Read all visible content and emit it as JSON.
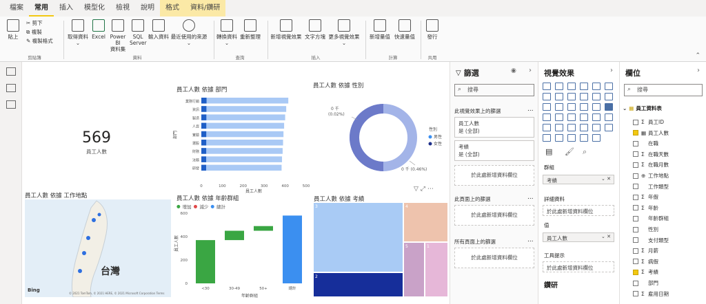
{
  "tabs": [
    "檔案",
    "常用",
    "插入",
    "模型化",
    "檢視",
    "說明",
    "格式",
    "資料/鑽研"
  ],
  "ribbon": {
    "clipboard": {
      "paste": "貼上",
      "cut": "剪下",
      "copy": "複製",
      "format_painter": "複製格式",
      "group": "剪貼簿"
    },
    "data": {
      "get_data": "取得資料",
      "excel": "Excel",
      "pbi_1": "Power BI",
      "pbi_2": "資料集",
      "sql_1": "SQL",
      "sql_2": "Server",
      "enter": "輸入資料",
      "recent": "最近使用的來源",
      "group": "資料"
    },
    "queries": {
      "transform": "轉換資料",
      "refresh": "重新整理",
      "group": "查詢"
    },
    "insert": {
      "new_visual": "新增視覺效果",
      "textbox": "文字方塊",
      "more_visuals": "更多視覺效果",
      "group": "插入"
    },
    "calc": {
      "new_measure": "新增量值",
      "quick_measure": "快速量值",
      "group": "計算"
    },
    "share": {
      "publish": "發行",
      "group": "共用"
    }
  },
  "card": {
    "value": "569",
    "label": "員工人數"
  },
  "bar_chart_title": "員工人數 依據 部門",
  "donut_title": "員工人數 依據 性別",
  "waterfall_title": "員工人數 依據 年齡群組",
  "treemap_title": "員工人數 依據 考績",
  "map_title": "員工人數 依據 工作地點",
  "map": {
    "region_label": "台灣",
    "bing": "Bing",
    "copyright": "© 2021 TomTom, © 2021 HERE, © 2021 Microsoft Corporation  Terms"
  },
  "chart_data": [
    {
      "type": "bar",
      "title": "員工人數 依據 部門",
      "categories": [
        "業務行銷",
        "資訊",
        "製造",
        "人資",
        "實驗",
        "選股",
        "財務",
        "法務",
        "研發"
      ],
      "series": [
        {
          "values": [
            415,
            405,
            400,
            395,
            392,
            390,
            388,
            385,
            383
          ]
        }
      ],
      "xlabel": "員工人數",
      "ylabel": "部門",
      "x_ticks": [
        "0",
        "100",
        "200",
        "300",
        "400",
        "500"
      ],
      "xlim": [
        0,
        500
      ]
    },
    {
      "type": "pie",
      "title": "員工人數 依據 性別",
      "legend_title": "性別",
      "legend": [
        "男性",
        "女性"
      ],
      "labels": [
        {
          "line1": "0 千",
          "line2": "(0.02%)"
        },
        {
          "line1": "0 千 (0.46%)"
        }
      ],
      "colors": [
        "#6c7ac9",
        "#a3b4e8"
      ]
    },
    {
      "type": "bar",
      "subtype": "waterfall",
      "title": "員工人數 依據 年齡群組",
      "legend": [
        "增加",
        "減少",
        "總計"
      ],
      "legend_colors": [
        "#3aa643",
        "#e04848",
        "#3b8ff0"
      ],
      "categories": [
        "<30",
        "30-49",
        "50+",
        "總計"
      ],
      "ranges": [
        [
          0,
          370
        ],
        [
          370,
          450
        ],
        [
          450,
          490
        ],
        [
          0,
          580
        ]
      ],
      "y_ticks": [
        "0",
        "200",
        "400",
        "600"
      ],
      "ylim": [
        0,
        600
      ],
      "xlabel": "年齡群組",
      "ylabel": "員工人數"
    },
    {
      "type": "heatmap",
      "subtype": "treemap",
      "title": "員工人數 依據 考績",
      "labels": [
        "3",
        "4",
        "2",
        "5",
        "1"
      ]
    }
  ],
  "filters": {
    "title": "篩選",
    "search": "搜尋",
    "visual_section": "此視覺效果上的篩選",
    "well1_name": "員工人數",
    "well1_val": "是 (全部)",
    "well2_name": "考績",
    "well2_val": "是 (全部)",
    "add_here": "於此處新增資料欄位",
    "page_section": "此頁面上的篩選",
    "all_section": "所有頁面上的篩選",
    "more": "..."
  },
  "viz": {
    "title": "視覺效果",
    "group_label": "群組",
    "group_value": "考績",
    "details_label": "詳細資料",
    "values_label": "值",
    "values_value": "員工人數",
    "tooltips_label": "工具提示",
    "add_here": "於此處新增資料欄位",
    "drill": "鑽研"
  },
  "fields": {
    "title": "欄位",
    "search": "搜尋",
    "table": "員工資料表",
    "items": [
      {
        "name": "員工ID",
        "sigma": "Σ",
        "on": false
      },
      {
        "name": "員工人數",
        "sigma": "▦",
        "on": true
      },
      {
        "name": "在職",
        "sigma": "",
        "on": false
      },
      {
        "name": "在職天數",
        "sigma": "Σ",
        "on": false
      },
      {
        "name": "在職月數",
        "sigma": "Σ",
        "on": false
      },
      {
        "name": "工作地點",
        "sigma": "⊕",
        "on": false
      },
      {
        "name": "工作類型",
        "sigma": "",
        "on": false
      },
      {
        "name": "年假",
        "sigma": "Σ",
        "on": false
      },
      {
        "name": "年齡",
        "sigma": "Σ",
        "on": false
      },
      {
        "name": "年齡群組",
        "sigma": "",
        "on": false
      },
      {
        "name": "性別",
        "sigma": "",
        "on": false
      },
      {
        "name": "支付類型",
        "sigma": "",
        "on": false
      },
      {
        "name": "月薪",
        "sigma": "Σ",
        "on": false
      },
      {
        "name": "病假",
        "sigma": "Σ",
        "on": false
      },
      {
        "name": "考績",
        "sigma": "Σ",
        "on": true
      },
      {
        "name": "部門",
        "sigma": "",
        "on": false
      },
      {
        "name": "雇用日期",
        "sigma": "Σ",
        "on": false
      }
    ]
  },
  "colors": {
    "accent": "#f2c811",
    "bar_dark": "#1f5fc7",
    "bar_light": "#a9c9f5"
  }
}
